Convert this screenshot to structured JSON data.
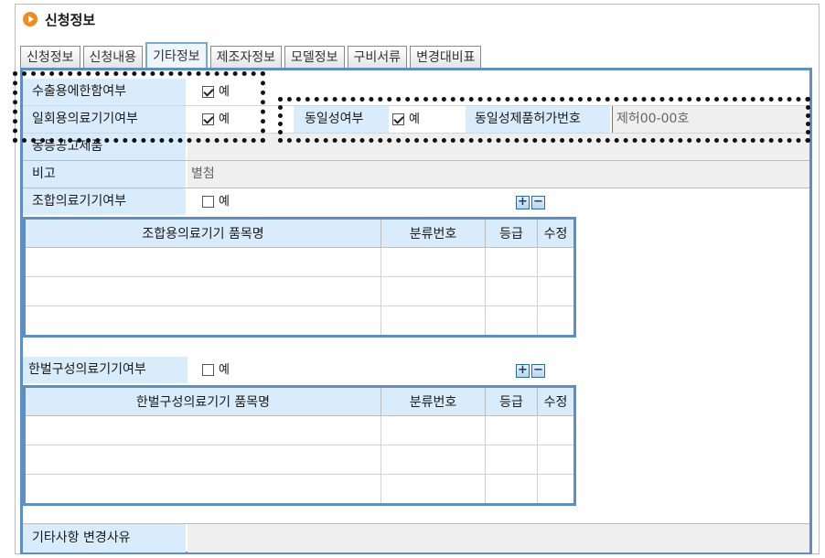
{
  "page": {
    "title": "신청정보"
  },
  "tabs": [
    {
      "label": "신청정보"
    },
    {
      "label": "신청내용"
    },
    {
      "label": "기타정보",
      "active": true
    },
    {
      "label": "제조자정보"
    },
    {
      "label": "모델정보"
    },
    {
      "label": "구비서류"
    },
    {
      "label": "변경대비표"
    }
  ],
  "form": {
    "export_only_label": "수출용에한함여부",
    "export_only_checked": true,
    "export_only_option": "예",
    "single_use_label": "일회용의료기기여부",
    "single_use_checked": true,
    "single_use_option": "예",
    "identity_label": "동일성여부",
    "identity_checked": true,
    "identity_option": "예",
    "identity_permit_label": "동일성제품허가번호",
    "identity_permit_value": "제허00-00호",
    "equivalent_notice_label": "동등공고제품",
    "equivalent_notice_value": "",
    "remarks_label": "비고",
    "remarks_value": "별첨",
    "combination_label": "조합의료기기여부",
    "combination_checked": false,
    "combination_option": "예",
    "kit_label": "한벌구성의료기기여부",
    "kit_checked": false,
    "kit_option": "예",
    "change_reason_label": "기타사항 변경사유",
    "change_reason_value": ""
  },
  "combination_table": {
    "headers": [
      "조합용의료기기 품목명",
      "분류번호",
      "등급",
      "수정"
    ],
    "rows": [
      [
        "",
        "",
        "",
        ""
      ],
      [
        "",
        "",
        "",
        ""
      ],
      [
        "",
        "",
        "",
        ""
      ]
    ]
  },
  "kit_table": {
    "headers": [
      "한벌구성의료기기 품목명",
      "분류번호",
      "등급",
      "수정"
    ],
    "rows": [
      [
        "",
        "",
        "",
        ""
      ],
      [
        "",
        "",
        "",
        ""
      ],
      [
        "",
        "",
        "",
        ""
      ]
    ]
  },
  "buttons": {
    "add_label": "+",
    "remove_label": "−"
  }
}
